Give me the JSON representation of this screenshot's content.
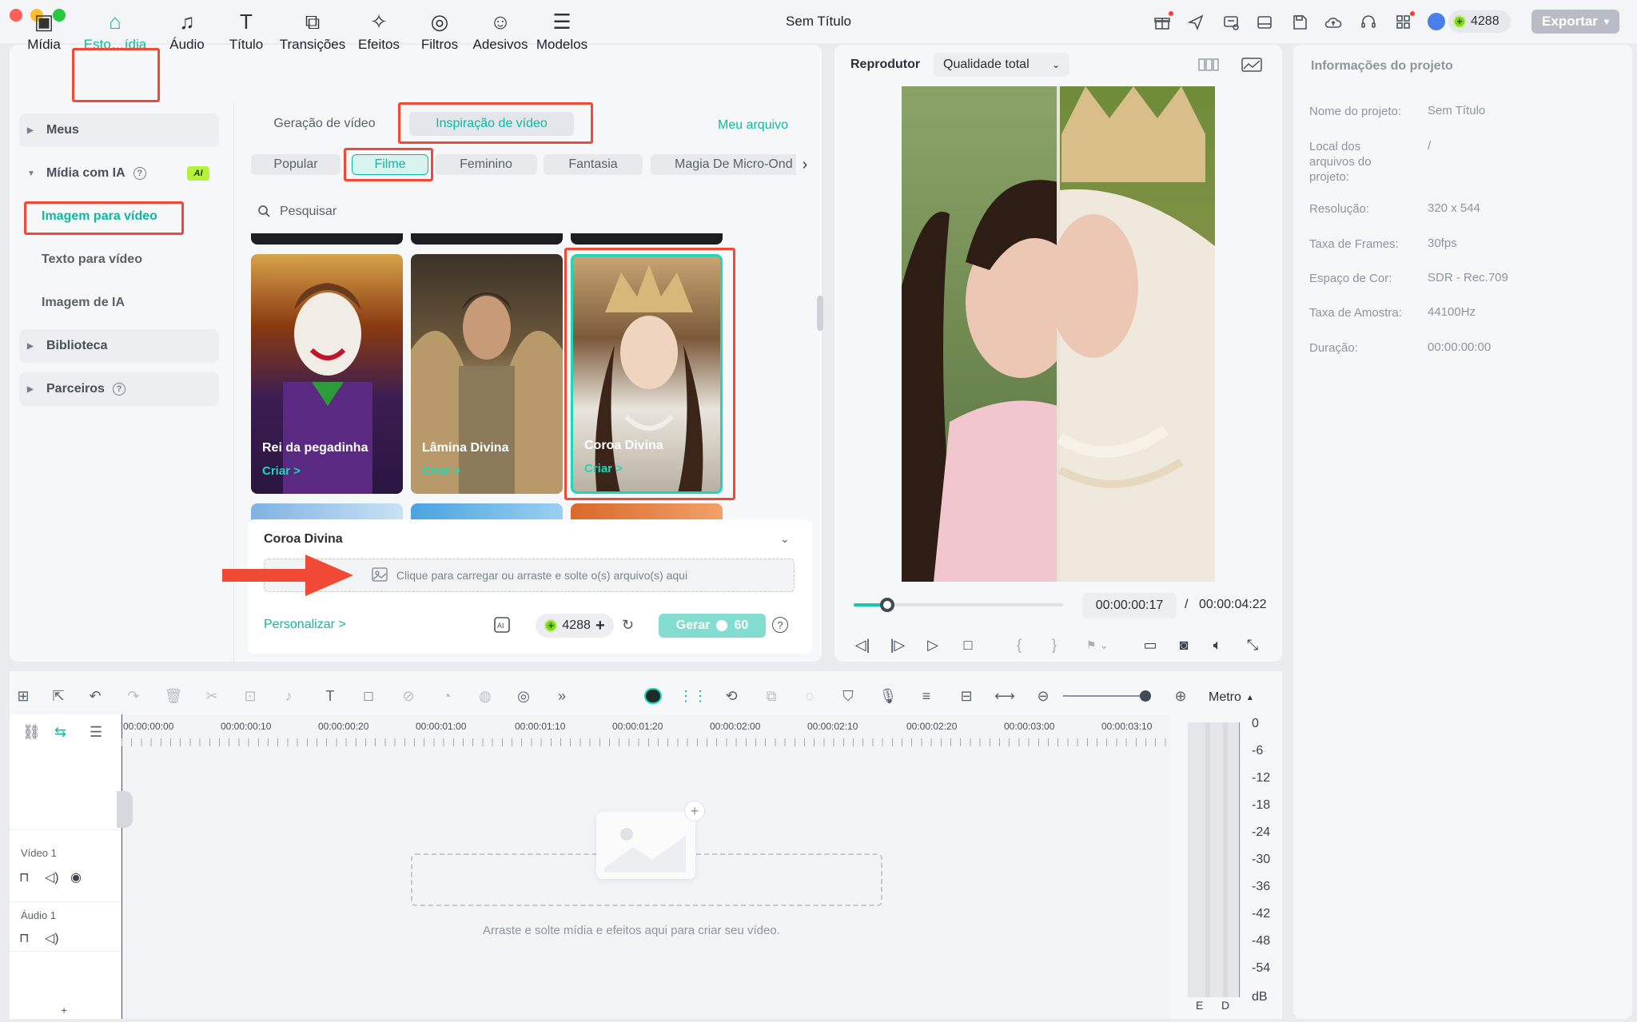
{
  "window": {
    "title": "Sem Título",
    "credits": "4288",
    "export_label": "Exportar"
  },
  "colors": {
    "accent": "#0fb8a0",
    "highlight": "#f04a36",
    "credit_gem": "#7ed321"
  },
  "top_tabs": [
    {
      "label": "Mídia",
      "icon": "media-icon"
    },
    {
      "label": "Esto…ídia",
      "icon": "store-icon"
    },
    {
      "label": "Áudio",
      "icon": "music-note-icon"
    },
    {
      "label": "Título",
      "icon": "text-title-icon"
    },
    {
      "label": "Transições",
      "icon": "transition-icon"
    },
    {
      "label": "Efeitos",
      "icon": "effects-icon"
    },
    {
      "label": "Filtros",
      "icon": "filter-icon"
    },
    {
      "label": "Adesivos",
      "icon": "sticker-icon"
    },
    {
      "label": "Modelos",
      "icon": "template-icon"
    }
  ],
  "sidebar": {
    "meus": "Meus",
    "midia_ia": "Mídia com IA",
    "ai_badge": "AI",
    "imagem_video": "Imagem para vídeo",
    "texto_video": "Texto para vídeo",
    "imagem_ia": "Imagem de IA",
    "biblioteca": "Biblioteca",
    "parceiros": "Parceiros"
  },
  "content": {
    "tab_geracao": "Geração de vídeo",
    "tab_inspiracao": "Inspiração de vídeo",
    "meu_arquivo": "Meu arquivo",
    "chips": [
      "Popular",
      "Filme",
      "Feminino",
      "Fantasia",
      "Magia De Micro-Ond"
    ],
    "search_placeholder": "Pesquisar",
    "cards": [
      {
        "title": "Rei da pegadinha",
        "cta": "Criar >"
      },
      {
        "title": "Lâmina Divina",
        "cta": "Criar >"
      },
      {
        "title": "Coroa Divina",
        "cta": "Criar >"
      }
    ],
    "selected_title": "Coroa Divina",
    "upload_hint": "Clique para carregar ou arraste e solte o(s) arquivo(s) aqui",
    "personalizar": "Personalizar >",
    "credits": "4288",
    "gerar": "Gerar",
    "gerar_cost": "60"
  },
  "player": {
    "label": "Reprodutor",
    "quality": "Qualidade total",
    "current_time": "00:00:00:17",
    "separator": "/",
    "total_time": "00:00:04:22",
    "progress": 0.16
  },
  "info": {
    "title": "Informações do projeto",
    "rows": [
      {
        "label": "Nome do projeto:",
        "value": "Sem Título"
      },
      {
        "label": "Local dos arquivos do projeto:",
        "value": "/"
      },
      {
        "label": "Resolução:",
        "value": "320 x 544"
      },
      {
        "label": "Taxa de Frames:",
        "value": "30fps"
      },
      {
        "label": "Espaço de Cor:",
        "value": "SDR - Rec.709"
      },
      {
        "label": "Taxa de Amostra:",
        "value": "44100Hz"
      },
      {
        "label": "Duração:",
        "value": "00:00:00:00"
      }
    ]
  },
  "timeline": {
    "meter_label": "Metro",
    "ruler": [
      "00:00:00:00",
      "00:00:00:10",
      "00:00:00:20",
      "00:00:01:00",
      "00:00:01:10",
      "00:00:01:20",
      "00:00:02:00",
      "00:00:02:10",
      "00:00:02:20",
      "00:00:03:00",
      "00:00:03:10"
    ],
    "tracks": [
      {
        "name": "Vídeo 1"
      },
      {
        "name": "Áudio 1"
      }
    ],
    "drop_hint": "Arraste e solte mídia e efeitos aqui para criar seu vídeo.",
    "db_scale": [
      "0",
      "-6",
      "-12",
      "-18",
      "-24",
      "-30",
      "-36",
      "-42",
      "-48",
      "-54",
      "dB"
    ],
    "channels": [
      "E",
      "D"
    ],
    "add_track": "+"
  }
}
